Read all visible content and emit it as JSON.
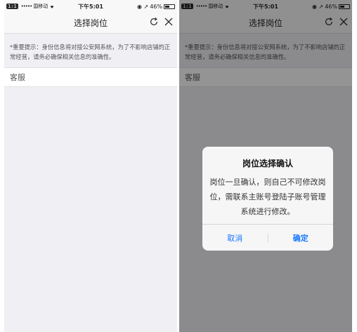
{
  "status_bar": {
    "tag": "1:1",
    "signal_dots": "•••••",
    "carrier": "国移动",
    "time": "下午5:01",
    "battery": "46%",
    "left_symbols": "◉ ➚"
  },
  "nav": {
    "title": "选择岗位"
  },
  "hint": {
    "text": "*重要提示：身份信息将对接公安网系统，为了不影响店铺的正常经营，请务必确保相关信息的准确性。"
  },
  "positions": [
    {
      "label": "客服"
    }
  ],
  "dialog": {
    "title": "岗位选择确认",
    "message": "岗位一旦确认，则自己不可修改岗位，需联系主账号登陆子账号管理系统进行修改。",
    "cancel_label": "取消",
    "confirm_label": "确定"
  },
  "colors": {
    "accent": "#1677ff",
    "overlay": "rgba(0,0,0,0.42)",
    "background": "#efeff4"
  },
  "icons": {
    "refresh": "refresh-icon",
    "close": "close-icon",
    "battery": "battery-icon",
    "wifi": "wifi-icon"
  }
}
